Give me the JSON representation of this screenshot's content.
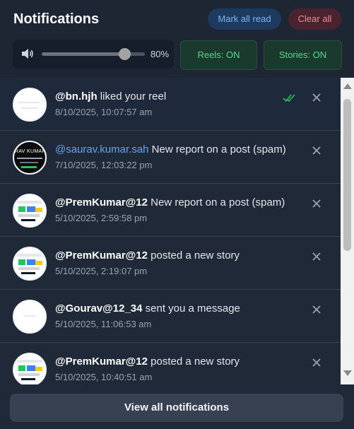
{
  "header": {
    "title": "Notifications",
    "mark_all_read": "Mark all read",
    "clear_all": "Clear all"
  },
  "volume": {
    "value_label": "80%",
    "level": 0.8
  },
  "toggles": {
    "reels": "Reels: ON",
    "stories": "Stories: ON"
  },
  "notifications": [
    {
      "user": "@bn.hjh",
      "text": " liked your reel",
      "time": "8/10/2025, 10:07:57 am"
    },
    {
      "user": "@saurav.kumar.sah",
      "text": " New report on a post (spam)",
      "time": "7/10/2025, 12:03:22 pm"
    },
    {
      "user": "@PremKumar@12",
      "text": " New report on a post (spam)",
      "time": "5/10/2025, 2:59:58 pm"
    },
    {
      "user": "@PremKumar@12",
      "text": " posted a new story",
      "time": "5/10/2025, 2:19:07 pm"
    },
    {
      "user": "@Gourav@12_34",
      "text": " sent you a message",
      "time": "5/10/2025, 11:06:53 am"
    },
    {
      "user": "@PremKumar@12",
      "text": " posted a new story",
      "time": "5/10/2025, 10:40:51 am"
    }
  ],
  "avatar_text": {
    "row2_line1": "RAV KUMAR"
  },
  "footer": {
    "view_all": "View all notifications"
  },
  "colors": {
    "accent_blue": "#60a5fa",
    "danger": "#f28b94",
    "success": "#5fd38d",
    "read_check": "#22c55e"
  }
}
